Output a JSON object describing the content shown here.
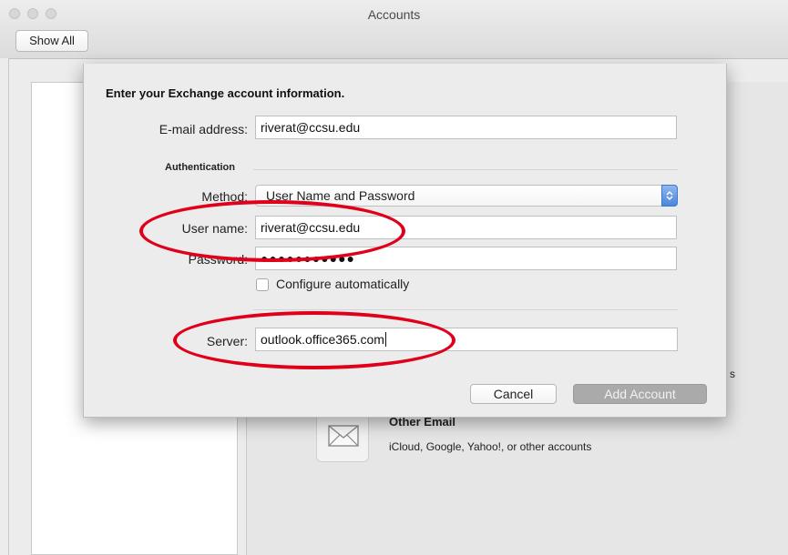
{
  "window": {
    "title": "Accounts",
    "show_all_label": "Show All"
  },
  "background": {
    "other_email_title": "Other Email",
    "other_email_subtitle": "iCloud, Google, Yahoo!, or other accounts",
    "partial_text": "s",
    "mail_icon": "envelope-icon"
  },
  "dialog": {
    "heading": "Enter your Exchange account information.",
    "email_label": "E-mail address:",
    "email_value": "riverat@ccsu.edu",
    "auth_section_title": "Authentication",
    "method_label": "Method:",
    "method_value": "User Name and Password",
    "username_label": "User name:",
    "username_value": "riverat@ccsu.edu",
    "password_label": "Password:",
    "password_value": "●●●●●●●●●●●",
    "configure_label": "Configure automatically",
    "configure_checked": false,
    "server_label": "Server:",
    "server_value": "outlook.office365.com",
    "cancel_label": "Cancel",
    "add_account_label": "Add Account"
  },
  "colors": {
    "annotation_red": "#e0001a",
    "select_accent": "#4b86de",
    "disabled_button": "#aaaaaa"
  }
}
